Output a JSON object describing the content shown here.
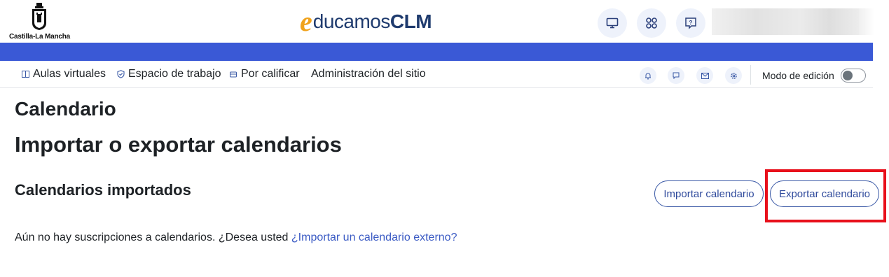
{
  "header": {
    "region_logo_text": "Castilla-La Mancha",
    "brand": {
      "e": "e",
      "ducamos": "ducamos",
      "clm": "CLM"
    },
    "icons": [
      "monitor-icon",
      "apps-grid-icon",
      "help-message-icon"
    ]
  },
  "colors": {
    "accent_band": "#3a59d6",
    "link": "#3b5bc4",
    "highlight": "#e8101b",
    "brand_orange": "#f0a21c",
    "brand_navy": "#1f3b6e"
  },
  "nav": {
    "items": [
      {
        "label": "Aulas virtuales",
        "icon": "book-icon"
      },
      {
        "label": "Espacio de trabajo",
        "icon": "shield-icon"
      },
      {
        "label": "Por calificar",
        "icon": "tray-icon"
      },
      {
        "label": "Administración del sitio",
        "icon": ""
      }
    ],
    "right_icons": [
      "bell-icon",
      "chat-icon",
      "mail-icon",
      "settings-icon"
    ],
    "edit_mode_label": "Modo de edición",
    "edit_mode_on": false
  },
  "main": {
    "heading": "Calendario",
    "title": "Importar o exportar calendarios",
    "section_title": "Calendarios importados",
    "import_button": "Importar calendario",
    "export_button": "Exportar calendario",
    "info_text": "Aún no hay suscripciones a calendarios. ¿Desea usted ",
    "info_link": "¿Importar un calendario externo?"
  }
}
